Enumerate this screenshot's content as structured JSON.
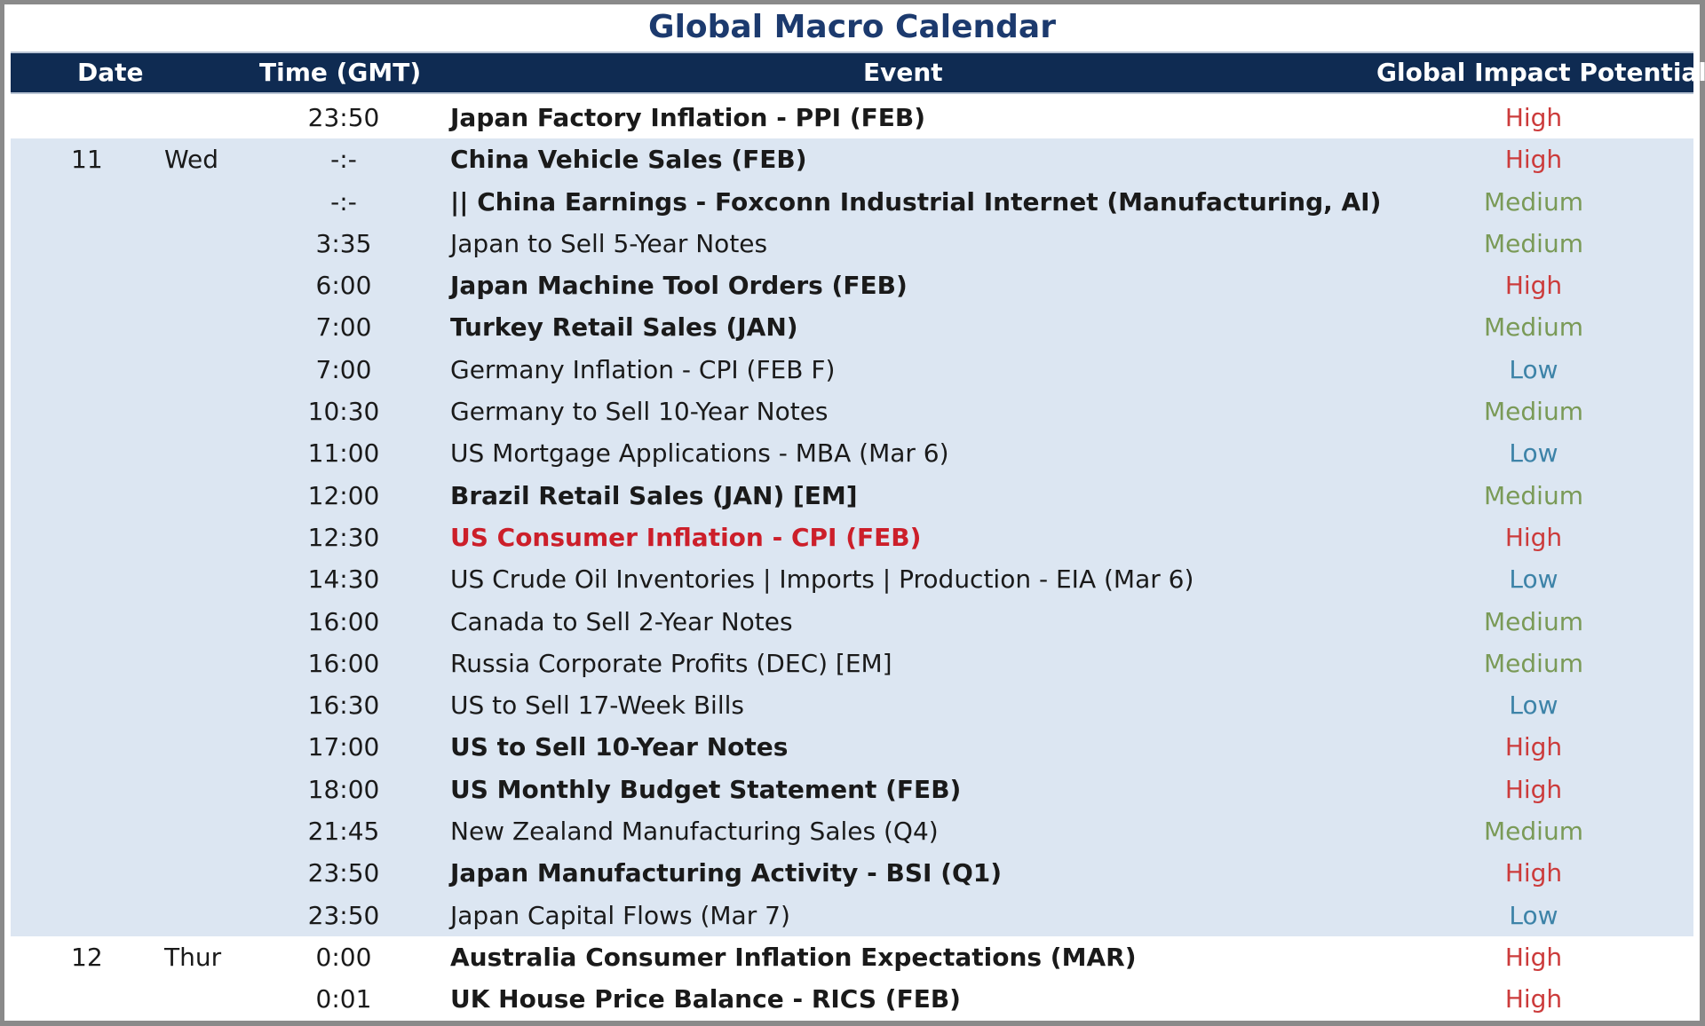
{
  "title": "Global Macro Calendar",
  "headers": {
    "date": "Date",
    "time": "Time (GMT)",
    "event": "Event",
    "impact": "Global Impact Potential"
  },
  "colors": {
    "header_bg": "#0f2b52",
    "title": "#1c3a6e",
    "row_shade": "#dce6f2",
    "high": "#cc3b3b",
    "medium": "#7a9a57",
    "low": "#3d83a8",
    "highlight_event": "#cc1f2a"
  },
  "rows": [
    {
      "day": "",
      "dow": "",
      "time": "23:50",
      "event": "Japan Factory Inflation - PPI (FEB)",
      "impact": "High",
      "bold": true,
      "shaded": false
    },
    {
      "day": "11",
      "dow": "Wed",
      "time": "-:-",
      "event": "China Vehicle Sales (FEB)",
      "impact": "High",
      "bold": true,
      "shaded": true
    },
    {
      "day": "",
      "dow": "",
      "time": "-:-",
      "event": "|| China Earnings - Foxconn Industrial Internet (Manufacturing, AI)",
      "impact": "Medium",
      "bold": true,
      "shaded": true
    },
    {
      "day": "",
      "dow": "",
      "time": "3:35",
      "event": "Japan to Sell 5-Year Notes",
      "impact": "Medium",
      "bold": false,
      "shaded": true
    },
    {
      "day": "",
      "dow": "",
      "time": "6:00",
      "event": "Japan Machine Tool Orders (FEB)",
      "impact": "High",
      "bold": true,
      "shaded": true
    },
    {
      "day": "",
      "dow": "",
      "time": "7:00",
      "event": "Turkey Retail Sales (JAN)",
      "impact": "Medium",
      "bold": true,
      "shaded": true
    },
    {
      "day": "",
      "dow": "",
      "time": "7:00",
      "event": "Germany Inflation - CPI (FEB F)",
      "impact": "Low",
      "bold": false,
      "shaded": true
    },
    {
      "day": "",
      "dow": "",
      "time": "10:30",
      "event": "Germany to Sell 10-Year Notes",
      "impact": "Medium",
      "bold": false,
      "shaded": true
    },
    {
      "day": "",
      "dow": "",
      "time": "11:00",
      "event": "US Mortgage Applications - MBA (Mar 6)",
      "impact": "Low",
      "bold": false,
      "shaded": true
    },
    {
      "day": "",
      "dow": "",
      "time": "12:00",
      "event": "Brazil Retail Sales (JAN) [EM]",
      "impact": "Medium",
      "bold": true,
      "shaded": true
    },
    {
      "day": "",
      "dow": "",
      "time": "12:30",
      "event": "US Consumer Inflation - CPI (FEB)",
      "impact": "High",
      "bold": true,
      "shaded": true,
      "red": true
    },
    {
      "day": "",
      "dow": "",
      "time": "14:30",
      "event": "US Crude Oil Inventories | Imports  | Production - EIA (Mar 6)",
      "impact": "Low",
      "bold": false,
      "shaded": true
    },
    {
      "day": "",
      "dow": "",
      "time": "16:00",
      "event": "Canada to Sell 2-Year Notes",
      "impact": "Medium",
      "bold": false,
      "shaded": true
    },
    {
      "day": "",
      "dow": "",
      "time": "16:00",
      "event": "Russia Corporate Profits (DEC) [EM]",
      "impact": "Medium",
      "bold": false,
      "shaded": true
    },
    {
      "day": "",
      "dow": "",
      "time": "16:30",
      "event": "US to Sell 17-Week Bills",
      "impact": "Low",
      "bold": false,
      "shaded": true
    },
    {
      "day": "",
      "dow": "",
      "time": "17:00",
      "event": "US to Sell 10-Year Notes",
      "impact": "High",
      "bold": true,
      "shaded": true
    },
    {
      "day": "",
      "dow": "",
      "time": "18:00",
      "event": "US Monthly Budget Statement (FEB)",
      "impact": "High",
      "bold": true,
      "shaded": true
    },
    {
      "day": "",
      "dow": "",
      "time": "21:45",
      "event": "New Zealand Manufacturing Sales (Q4)",
      "impact": "Medium",
      "bold": false,
      "shaded": true
    },
    {
      "day": "",
      "dow": "",
      "time": "23:50",
      "event": "Japan Manufacturing Activity - BSI (Q1)",
      "impact": "High",
      "bold": true,
      "shaded": true
    },
    {
      "day": "",
      "dow": "",
      "time": "23:50",
      "event": "Japan Capital Flows (Mar 7)",
      "impact": "Low",
      "bold": false,
      "shaded": true
    },
    {
      "day": "12",
      "dow": "Thur",
      "time": "0:00",
      "event": "Australia Consumer Inflation Expectations (MAR)",
      "impact": "High",
      "bold": true,
      "shaded": false
    },
    {
      "day": "",
      "dow": "",
      "time": "0:01",
      "event": "UK House Price Balance - RICS (FEB)",
      "impact": "High",
      "bold": true,
      "shaded": false
    }
  ]
}
